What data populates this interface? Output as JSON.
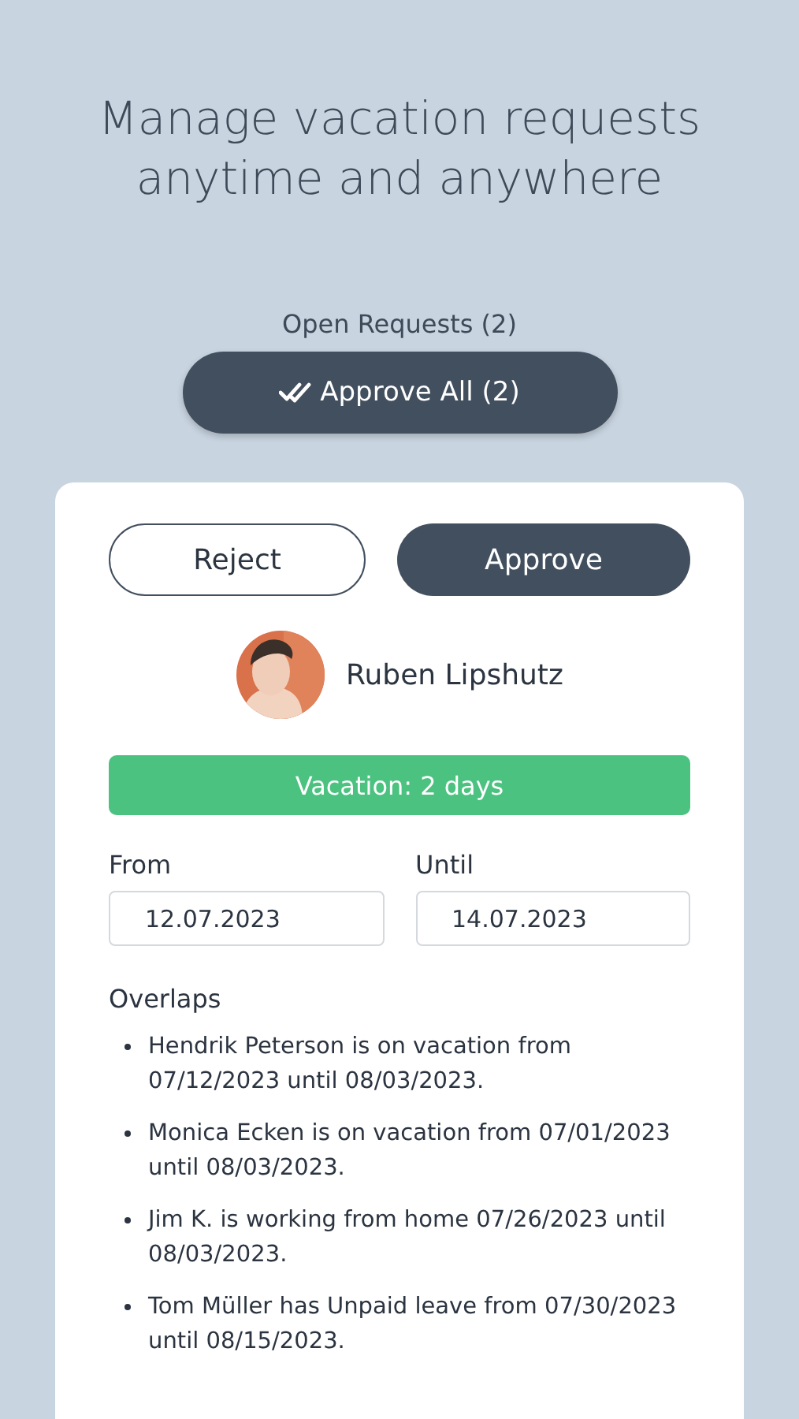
{
  "headline": "Manage vacation requests anytime and anywhere",
  "open_requests": {
    "label": "Open Requests (2)",
    "approve_all_button": "Approve All (2)"
  },
  "request": {
    "reject_button": "Reject",
    "approve_button": "Approve",
    "employee": {
      "name": "Ruben Lipshutz"
    },
    "type_banner": {
      "text": "Vacation: 2 days",
      "color": "#4bc27f"
    },
    "from": {
      "label": "From",
      "value": "12.07.2023"
    },
    "until": {
      "label": "Until",
      "value": "14.07.2023"
    },
    "overlaps": {
      "title": "Overlaps",
      "items": [
        "Hendrik Peterson is on vacation from 07/12/2023 until 08/03/2023.",
        "Monica Ecken is on vacation from 07/01/2023 until 08/03/2023.",
        "Jim K. is working from home 07/26/2023 until 08/03/2023.",
        "Tom Müller has Unpaid leave from 07/30/2023 until 08/15/2023."
      ]
    }
  }
}
